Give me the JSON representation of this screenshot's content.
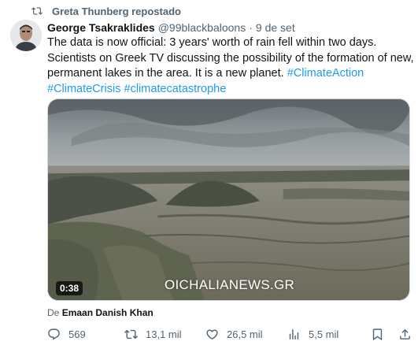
{
  "repost_banner": {
    "icon": "repost-icon",
    "text": "Greta Thunberg repostado"
  },
  "tweet": {
    "author_name": "George Tsakraklides",
    "handle": "@99blackbaloons",
    "separator": "·",
    "date": "9 de set",
    "text_lines": [
      "The data is now official: 3 years' worth of rain fell within two days.",
      "Scientists on Greek TV discussing the possibility of the formation of new,",
      "permanent lakes in the area.  It is a new planet."
    ],
    "hashtags_inline": "#ClimateAction",
    "hashtags_line": [
      "#ClimateCrisis",
      "#climatecatastrophe"
    ]
  },
  "media": {
    "type": "video",
    "duration": "0:38",
    "watermark": "OICHALIANEWS.GR"
  },
  "attribution": {
    "prefix": "De",
    "source": "Emaan Danish Khan"
  },
  "actions": {
    "reply_count": "569",
    "retweet_count": "13,1 mil",
    "like_count": "26,5 mil",
    "view_count": "5,5 mil"
  },
  "colors": {
    "text": "#0f1419",
    "secondary": "#536471",
    "link": "#1d9bf0"
  }
}
